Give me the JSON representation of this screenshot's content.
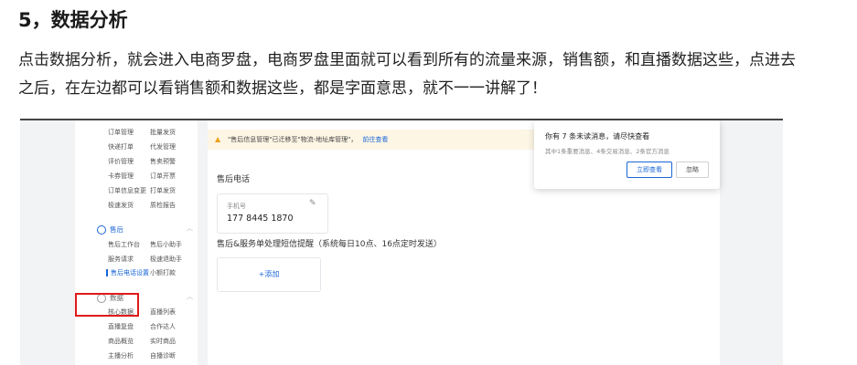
{
  "article": {
    "heading": "5，数据分析",
    "paragraph": "点击数据分析，就会进入电商罗盘，电商罗盘里面就可以看到所有的流量来源，销售额，和直播数据这些，点进去之后，在左边都可以看销售额和数据这些，都是字面意思，就不一一讲解了！"
  },
  "screenshot": {
    "sidebar": {
      "order_group": [
        [
          "订单管理",
          "批量发货"
        ],
        [
          "快递打单",
          "代发管理"
        ],
        [
          "评价管理",
          "售卖预警"
        ],
        [
          "卡券管理",
          "订单开票"
        ],
        [
          "订单信息变更",
          "打单发货"
        ],
        [
          "极速发货",
          "质检报告"
        ]
      ],
      "aftersale_section": "售后",
      "aftersale_group": [
        [
          "售后工作台",
          "售后小助手"
        ],
        [
          "服务请求",
          "极速退助手"
        ],
        [
          "售后电话设置",
          "小额打款"
        ]
      ],
      "data_section": "数据",
      "data_group": [
        [
          "核心数据",
          "直播列表"
        ],
        [
          "直播复盘",
          "合作达人"
        ],
        [
          "商品概览",
          "实时商品"
        ],
        [
          "主播分析",
          "自播诊断"
        ]
      ]
    },
    "notice": {
      "text": "\"售后信息管理\"已迁移至\"物流-地址库管理\"，",
      "link": "前往查看"
    },
    "phone_section": {
      "title": "售后电话",
      "label": "手机号",
      "value": "177 8445 1870"
    },
    "sms_section": {
      "title": "售后&服务单处理短信提醒（系统每日10点、16点定时发送）",
      "add_label": "+添加"
    },
    "popup": {
      "title": "你有 7 条未读消息，请尽快查看",
      "subtitle": "其中1条重要消息、4条交易消息、2条官方消息",
      "primary_button": "立即查看",
      "ignore_button": "忽略"
    }
  }
}
